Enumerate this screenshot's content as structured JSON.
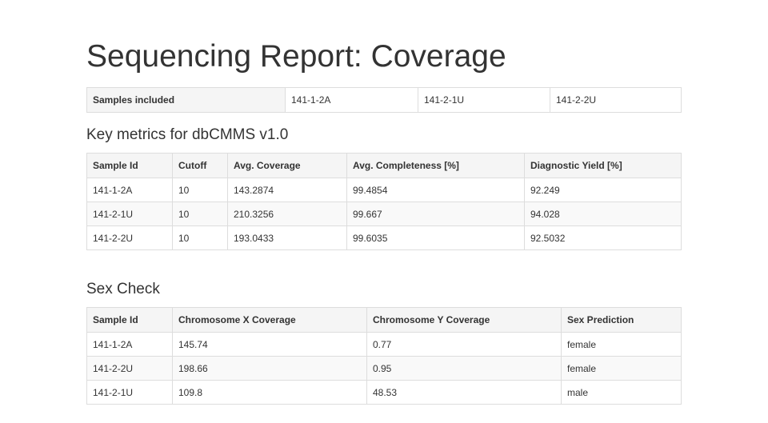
{
  "page": {
    "title": "Sequencing Report: Coverage"
  },
  "samples": {
    "label": "Samples included",
    "values": [
      "141-1-2A",
      "141-2-1U",
      "141-2-2U"
    ]
  },
  "metrics": {
    "title": "Key metrics for dbCMMS v1.0",
    "columns": [
      "Sample Id",
      "Cutoff",
      "Avg. Coverage",
      "Avg. Completeness [%]",
      "Diagnostic Yield [%]"
    ],
    "rows": [
      [
        "141-1-2A",
        "10",
        "143.2874",
        "99.4854",
        "92.249"
      ],
      [
        "141-2-1U",
        "10",
        "210.3256",
        "99.667",
        "94.028"
      ],
      [
        "141-2-2U",
        "10",
        "193.0433",
        "99.6035",
        "92.5032"
      ]
    ]
  },
  "sex_check": {
    "title": "Sex Check",
    "columns": [
      "Sample Id",
      "Chromosome X Coverage",
      "Chromosome Y Coverage",
      "Sex Prediction"
    ],
    "rows": [
      [
        "141-1-2A",
        "145.74",
        "0.77",
        "female"
      ],
      [
        "141-2-2U",
        "198.66",
        "0.95",
        "female"
      ],
      [
        "141-2-1U",
        "109.8",
        "48.53",
        "male"
      ]
    ]
  }
}
